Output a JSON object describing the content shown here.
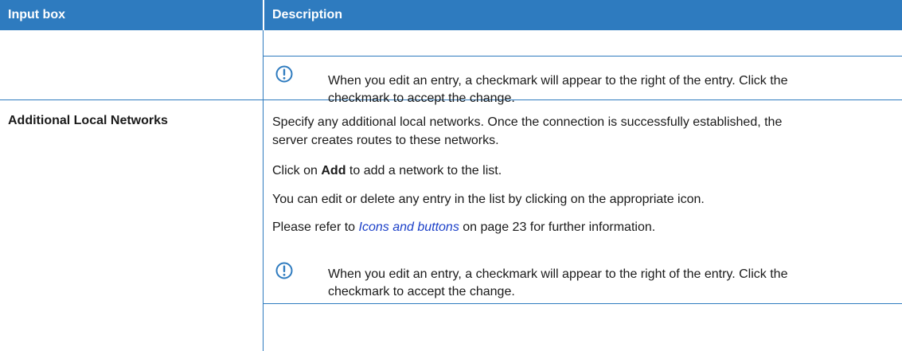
{
  "header": {
    "col1": "Input box",
    "col2": "Description"
  },
  "rows": [
    {
      "label": "",
      "note": {
        "icon": "exclamation-circle-icon",
        "line1": "When you edit an entry, a checkmark will appear to the right of the entry. Click the",
        "line2": "checkmark to accept the change."
      }
    },
    {
      "label": "Additional Local Networks",
      "para1_line1": "Specify any additional local networks. Once the connection is successfully established, the",
      "para1_line2": "server creates routes to these networks.",
      "para2_pre": "Click on ",
      "para2_bold": "Add",
      "para2_post": " to add a network to the list.",
      "para3": "You can edit or delete any entry in the list by clicking on the appropriate icon.",
      "para4_pre": "Please refer to ",
      "para4_link": "Icons and buttons",
      "para4_post": " on page 23 for further information.",
      "note": {
        "icon": "exclamation-circle-icon",
        "line1": "When you edit an entry, a checkmark will appear to the right of the entry. Click the",
        "line2": "checkmark to accept the change."
      }
    }
  ],
  "colors": {
    "accent": "#2e7bbf",
    "link": "#1a3fc8"
  }
}
